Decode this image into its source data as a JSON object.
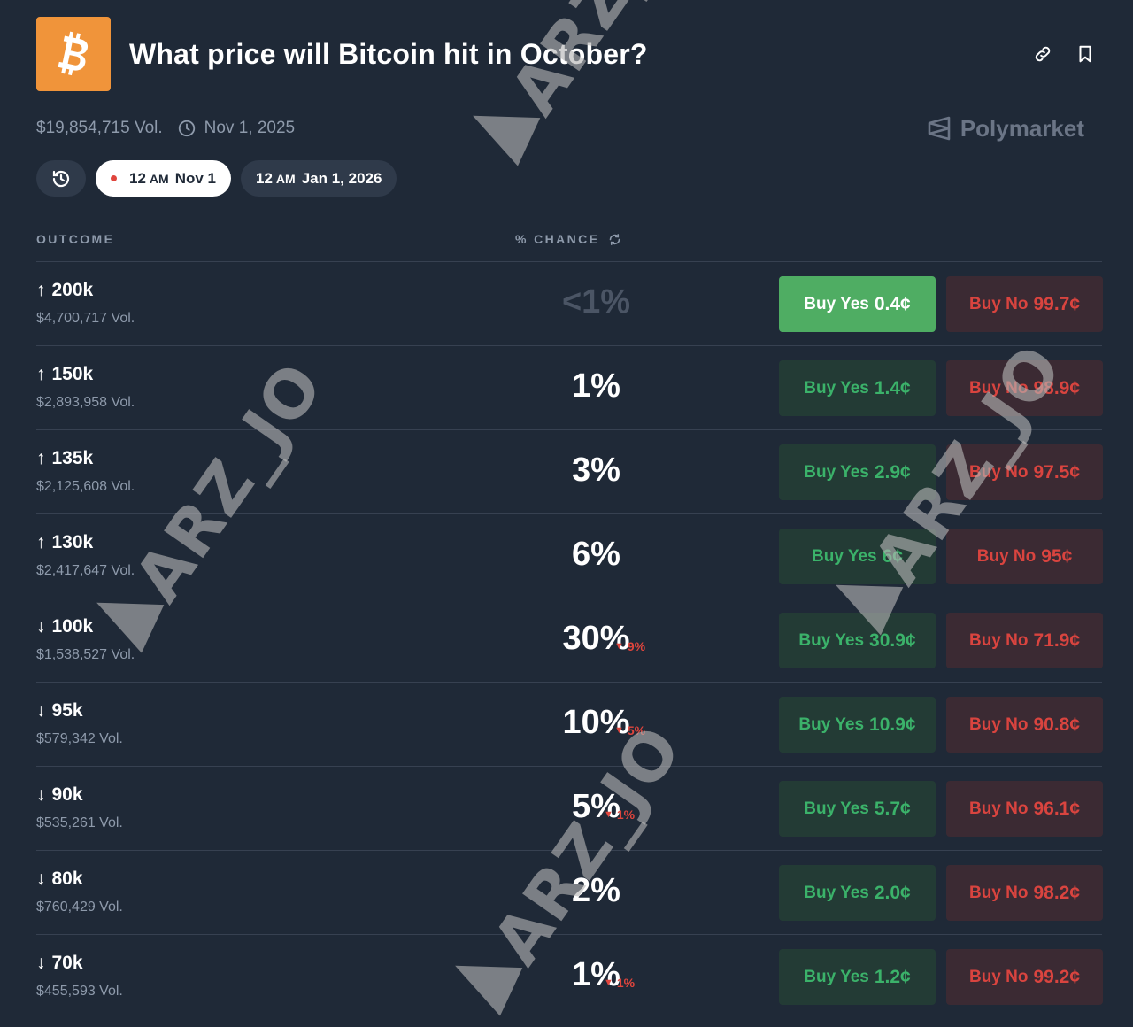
{
  "header": {
    "title": "What price will Bitcoin hit in October?",
    "brand_color": "#f0943a"
  },
  "meta": {
    "volume": "$19,854,715 Vol.",
    "end_date": "Nov 1, 2025",
    "brand": "Polymarket"
  },
  "chips": {
    "active": {
      "time": "12",
      "ampm": "AM",
      "date": "Nov 1"
    },
    "other": {
      "time": "12",
      "ampm": "AM",
      "date": "Jan 1, 2026"
    }
  },
  "table": {
    "col_outcome": "OUTCOME",
    "col_chance": "% CHANCE"
  },
  "rows": [
    {
      "dir": "↑",
      "label": "200k",
      "vol": "$4,700,717 Vol.",
      "chance": "<1%",
      "delta": "",
      "yes_label": "Buy Yes",
      "yes_price": "0.4¢",
      "no_label": "Buy No",
      "no_price": "99.7¢"
    },
    {
      "dir": "↑",
      "label": "150k",
      "vol": "$2,893,958 Vol.",
      "chance": "1%",
      "delta": "",
      "yes_label": "Buy Yes",
      "yes_price": "1.4¢",
      "no_label": "Buy No",
      "no_price": "98.9¢"
    },
    {
      "dir": "↑",
      "label": "135k",
      "vol": "$2,125,608 Vol.",
      "chance": "3%",
      "delta": "",
      "yes_label": "Buy Yes",
      "yes_price": "2.9¢",
      "no_label": "Buy No",
      "no_price": "97.5¢"
    },
    {
      "dir": "↑",
      "label": "130k",
      "vol": "$2,417,647 Vol.",
      "chance": "6%",
      "delta": "",
      "yes_label": "Buy Yes",
      "yes_price": "6¢",
      "no_label": "Buy No",
      "no_price": "95¢"
    },
    {
      "dir": "↓",
      "label": "100k",
      "vol": "$1,538,527 Vol.",
      "chance": "30%",
      "delta": "9%",
      "yes_label": "Buy Yes",
      "yes_price": "30.9¢",
      "no_label": "Buy No",
      "no_price": "71.9¢"
    },
    {
      "dir": "↓",
      "label": "95k",
      "vol": "$579,342 Vol.",
      "chance": "10%",
      "delta": "5%",
      "yes_label": "Buy Yes",
      "yes_price": "10.9¢",
      "no_label": "Buy No",
      "no_price": "90.8¢"
    },
    {
      "dir": "↓",
      "label": "90k",
      "vol": "$535,261 Vol.",
      "chance": "5%",
      "delta": "1%",
      "yes_label": "Buy Yes",
      "yes_price": "5.7¢",
      "no_label": "Buy No",
      "no_price": "96.1¢"
    },
    {
      "dir": "↓",
      "label": "80k",
      "vol": "$760,429 Vol.",
      "chance": "2%",
      "delta": "",
      "yes_label": "Buy Yes",
      "yes_price": "2.0¢",
      "no_label": "Buy No",
      "no_price": "98.2¢"
    },
    {
      "dir": "↓",
      "label": "70k",
      "vol": "$455,593 Vol.",
      "chance": "1%",
      "delta": "1%",
      "yes_label": "Buy Yes",
      "yes_price": "1.2¢",
      "no_label": "Buy No",
      "no_price": "99.2¢"
    }
  ],
  "watermark": "ARZ_JO",
  "colors": {
    "background": "#1f2937",
    "yes_text": "#3bb26a",
    "yes_bg": "#233b35",
    "yes_highlight": "#4fad63",
    "no_text": "#d9443f",
    "no_bg": "#3b2a33",
    "delta_down": "#e0453d"
  }
}
